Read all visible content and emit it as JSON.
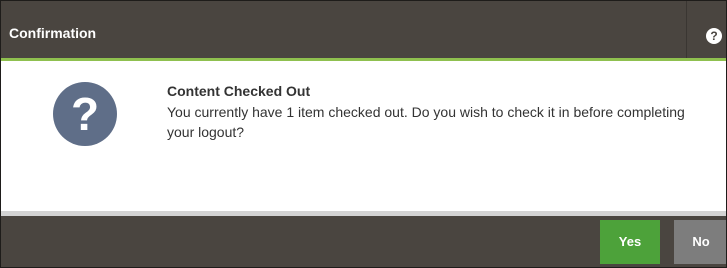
{
  "dialog": {
    "title": "Confirmation",
    "help_icon_glyph": "?",
    "message_icon_glyph": "?",
    "message_title": "Content Checked Out",
    "message_body": "You currently have 1 item checked out. Do you wish to check it in before completing your logout?",
    "buttons": {
      "yes_label": "Yes",
      "no_label": "No"
    }
  },
  "colors": {
    "titlebar_bg": "#4a4540",
    "accent_line": "#8fc04f",
    "question_icon": "#5f6e88",
    "yes_button": "#4da23a",
    "no_button": "#7d7d7d"
  },
  "icons": {
    "help": "help-icon",
    "message": "question-icon"
  }
}
